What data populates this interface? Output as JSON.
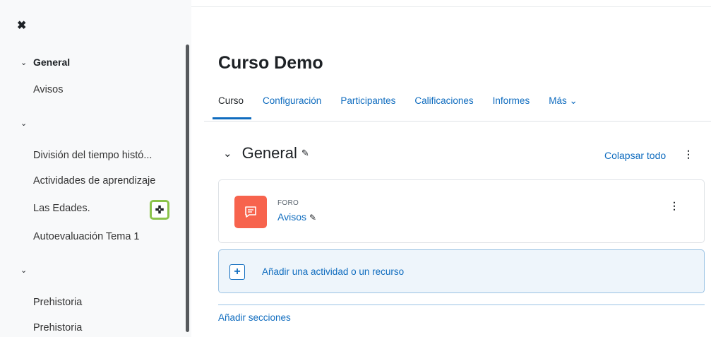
{
  "drawer": {
    "close_icon": "close-icon",
    "sections": [
      {
        "label": "General",
        "items": [
          "Avisos"
        ]
      },
      {
        "label": "",
        "items": [
          "División del tiempo histó...",
          "Actividades de aprendizaje",
          "Las Edades.",
          "Autoevaluación Tema 1"
        ]
      },
      {
        "label": "",
        "items": [
          "Prehistoria",
          "Prehistoria"
        ]
      }
    ],
    "add_handle_icon": "move-plus-icon"
  },
  "main": {
    "course_title": "Curso Demo",
    "tabs": [
      {
        "label": "Curso",
        "active": true
      },
      {
        "label": "Configuración"
      },
      {
        "label": "Participantes"
      },
      {
        "label": "Calificaciones"
      },
      {
        "label": "Informes"
      },
      {
        "label": "Más ⌄"
      }
    ],
    "section": {
      "title": "General",
      "collapse_label": "Colapsar todo"
    },
    "activity": {
      "type": "FORO",
      "name": "Avisos",
      "icon": "forum-icon"
    },
    "add_activity_label": "Añadir una actividad o un recurso",
    "add_sections_label": "Añadir secciones"
  },
  "colors": {
    "link": "#0f6cbf",
    "forum_icon_bg": "#f7634d",
    "highlight_border": "#8bc34a",
    "add_activity_bg": "#eef5fb"
  }
}
